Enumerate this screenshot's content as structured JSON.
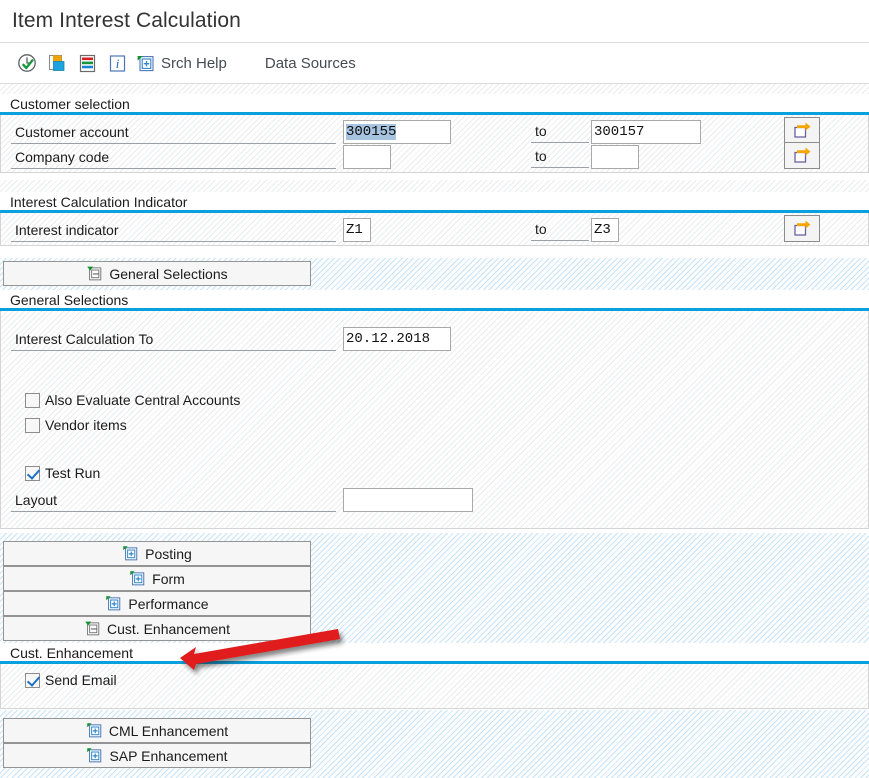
{
  "window": {
    "title": "Item Interest Calculation"
  },
  "toolbar": {
    "icons": [
      {
        "name": "execute-clock-icon",
        "label": ""
      },
      {
        "name": "copy-layers-icon",
        "label": ""
      },
      {
        "name": "variants-list-icon",
        "label": ""
      },
      {
        "name": "information-icon",
        "label": ""
      }
    ],
    "search_help": {
      "icon": "expand-node-icon",
      "label": "Srch Help"
    },
    "data_sources_label": "Data Sources"
  },
  "sections": {
    "customer_selection": {
      "header": "Customer selection",
      "rows": [
        {
          "label": "Customer account",
          "from_value": "300155",
          "from_selected": true,
          "to_label": "to",
          "to_value": "300157",
          "multi_select_icon": "multiple-selection-icon"
        },
        {
          "label": "Company code",
          "from_value": "",
          "from_selected": false,
          "to_label": "to",
          "to_value": "",
          "multi_select_icon": "multiple-selection-icon"
        }
      ]
    },
    "interest_calculation_indicator": {
      "header": "Interest Calculation Indicator",
      "rows": [
        {
          "label": "Interest indicator",
          "from_value": "Z1",
          "to_label": "to",
          "to_value": "Z3",
          "multi_select_icon": "multiple-selection-icon"
        }
      ]
    },
    "general_selections": {
      "toggle_label": "General Selections",
      "toggle_icon": "collapse-minus-icon",
      "expanded": true,
      "header": "General Selections",
      "date_field": {
        "label": "Interest Calculation To",
        "value": "20.12.2018"
      },
      "checkboxes": [
        {
          "label": "Also Evaluate Central Accounts",
          "checked": false
        },
        {
          "label": "Vendor items",
          "checked": false
        },
        {
          "label": "Test Run",
          "checked": true
        }
      ],
      "layout_field": {
        "label": "Layout",
        "value": ""
      }
    },
    "button_strip_middle": [
      {
        "label": "Posting",
        "icon": "expand-plus-icon",
        "expanded": false
      },
      {
        "label": "Form",
        "icon": "expand-plus-icon",
        "expanded": false
      },
      {
        "label": "Performance",
        "icon": "expand-plus-icon",
        "expanded": false
      },
      {
        "label": "Cust. Enhancement",
        "icon": "collapse-minus-icon",
        "expanded": true
      }
    ],
    "cust_enhancement": {
      "header": "Cust. Enhancement",
      "checkboxes": [
        {
          "label": "Send Email",
          "checked": true
        }
      ]
    },
    "button_strip_bottom": [
      {
        "label": "CML Enhancement",
        "icon": "expand-plus-icon",
        "expanded": false
      },
      {
        "label": "SAP Enhancement",
        "icon": "expand-plus-icon",
        "expanded": false
      }
    ]
  },
  "annotation": {
    "name": "red-arrow-pointing-to-cust-enhancement",
    "color": "#e01b1b",
    "points_to": "Cust. Enhancement"
  },
  "colors": {
    "accent_blue": "#0aa0dd",
    "selection_blue": "#a6c4e0",
    "annotation_red": "#e01b1b",
    "check_blue": "#1a72c4"
  }
}
